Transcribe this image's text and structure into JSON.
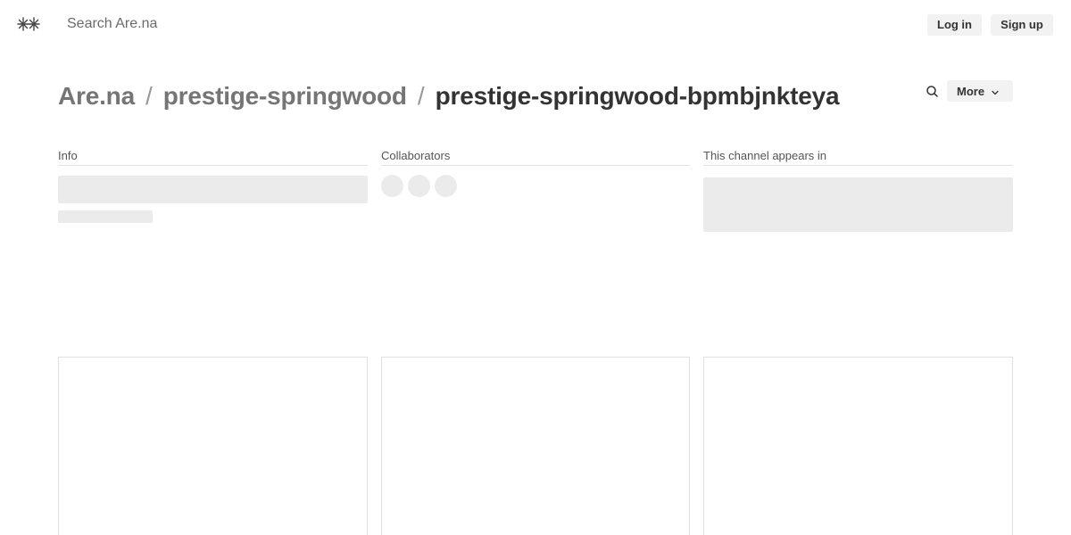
{
  "header": {
    "search": {
      "placeholder": "Search Are.na",
      "value": ""
    },
    "login_label": "Log in",
    "signup_label": "Sign up"
  },
  "breadcrumb": {
    "items": [
      "Are.na",
      "prestige-springwood",
      "prestige-springwood-bpmbjnkteya"
    ],
    "separator": "/"
  },
  "actions": {
    "more_label": "More"
  },
  "meta": {
    "info_label": "Info",
    "collaborators_label": "Collaborators",
    "appears_in_label": "This channel appears in"
  },
  "icons": {
    "logo": "arena-logo-icon",
    "search": "search-icon",
    "more": "chevron-down-icon"
  }
}
